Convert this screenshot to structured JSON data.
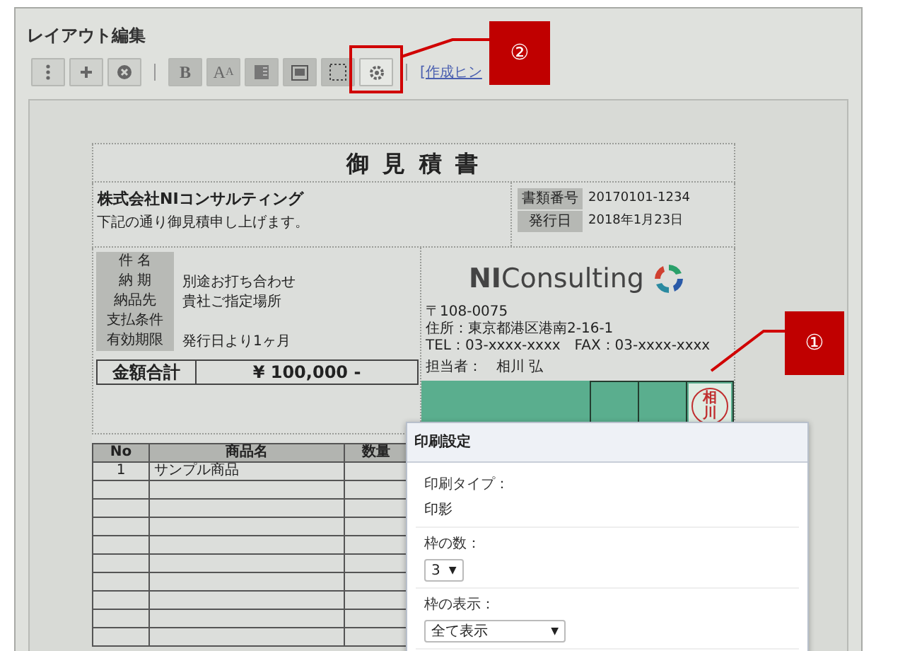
{
  "window": {
    "title": "レイアウト編集"
  },
  "toolbar": {
    "buttons": [
      {
        "kind": "more",
        "disabled": false,
        "highlighted": false
      },
      {
        "kind": "add",
        "disabled": false,
        "highlighted": false
      },
      {
        "kind": "delete",
        "disabled": false,
        "highlighted": false
      },
      {
        "kind": "bold",
        "label": "B",
        "disabled": true,
        "highlighted": false
      },
      {
        "kind": "font-size",
        "label": "A",
        "sub_label": "A",
        "disabled": true,
        "highlighted": false
      },
      {
        "kind": "align",
        "disabled": true,
        "highlighted": false
      },
      {
        "kind": "frame",
        "disabled": true,
        "highlighted": false
      },
      {
        "kind": "dotted-frame",
        "disabled": true,
        "highlighted": false
      },
      {
        "kind": "settings",
        "disabled": false,
        "highlighted": true
      }
    ],
    "hint_link": "[作成ヒン"
  },
  "document": {
    "title": "御 見 積 書",
    "customer": "株式会社NIコンサルティング",
    "greeting": "下記の通り御見積申し上げます。",
    "meta": [
      {
        "label": "書類番号",
        "value": "20170101-1234"
      },
      {
        "label": "発行日",
        "value": "2018年1月23日"
      }
    ],
    "details": [
      {
        "label": "件 名"
      },
      {
        "label": "納 期",
        "value": "別途お打ち合わせ"
      },
      {
        "label": "納品先",
        "value": "貴社ご指定場所"
      },
      {
        "label": "支払条件"
      },
      {
        "label": "有効期限",
        "value": "発行日より1ヶ月"
      }
    ],
    "total": {
      "label": "金額合計",
      "value": "¥ 100,000 -"
    },
    "issuer": {
      "logo": {
        "bold": "NI",
        "text": "Consulting"
      },
      "address_lines": [
        "〒108-0075",
        "住所：東京都港区港南2-16-1",
        "TEL：03-xxxx-xxxx　FAX：03-xxxx-xxxx"
      ],
      "staff_label": "担当者：",
      "staff_name": "相川 弘"
    },
    "stamp_boxes": [
      {
        "kind": "empty"
      },
      {
        "kind": "empty"
      },
      {
        "kind": "seal",
        "seal": "相川"
      }
    ],
    "table": {
      "columns": [
        "No",
        "商品名",
        "数量"
      ],
      "rows": [
        {
          "kind": "item",
          "no": "1",
          "name": "サンプル商品"
        },
        {
          "kind": "blank"
        },
        {
          "kind": "blank"
        },
        {
          "kind": "blank"
        },
        {
          "kind": "blank"
        },
        {
          "kind": "blank"
        },
        {
          "kind": "blank"
        },
        {
          "kind": "blank"
        },
        {
          "kind": "blank"
        },
        {
          "kind": "blank"
        }
      ]
    }
  },
  "print_settings": {
    "title": "印刷設定",
    "fields": [
      {
        "kind": "text",
        "label": "印刷タイプ：",
        "value": "印影"
      },
      {
        "kind": "select",
        "label": "枠の数：",
        "value": "3",
        "caret": "▼"
      },
      {
        "kind": "select",
        "label": "枠の表示：",
        "value": "全て表示",
        "caret": "▼"
      }
    ]
  },
  "callouts": [
    {
      "number": "①"
    },
    {
      "number": "②"
    }
  ]
}
